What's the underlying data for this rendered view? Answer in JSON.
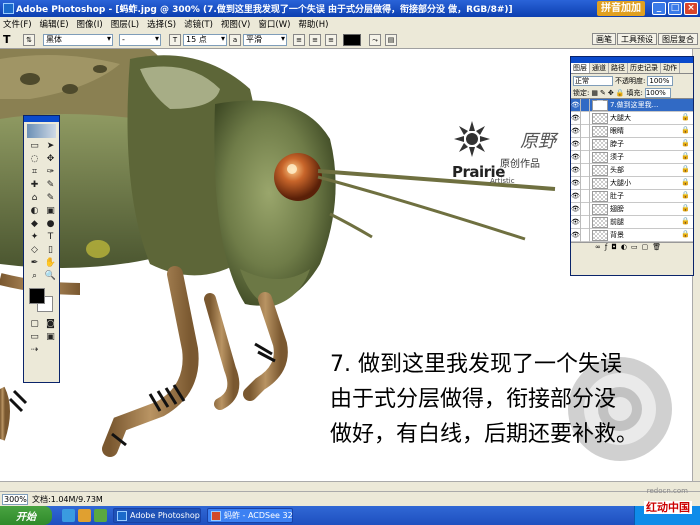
{
  "window": {
    "title": "Adobe Photoshop - [蚂蚱.jpg @ 300% (7.做到这里我发现了一个失误 由于式分层做得，衔接部分没 做，RGB/8#)]",
    "brand_badge": "拼音加加"
  },
  "menu": [
    "文件(F)",
    "编辑(E)",
    "图像(I)",
    "图层(L)",
    "选择(S)",
    "滤镜(T)",
    "视图(V)",
    "窗口(W)",
    "帮助(H)"
  ],
  "options_bar": {
    "tool_glyph": "T",
    "font_family": "黑体",
    "font_style": "-",
    "font_size": "15 点",
    "antialias": "平滑",
    "palette_tabs": [
      "画笔",
      "工具预设",
      "图层复合"
    ]
  },
  "toolbox": {
    "tools": [
      "▭",
      "➤",
      "◌",
      "✥",
      "⌗",
      "✑",
      "✚",
      "✎",
      "⌂",
      "✎",
      "◐",
      "▣",
      "◆",
      "●",
      "✦",
      "T",
      "◇",
      "▯",
      "✒",
      "✋",
      "⌕",
      "🔍"
    ]
  },
  "layers_palette": {
    "tabs": [
      "图层",
      "通道",
      "路径",
      "历史记录",
      "动作"
    ],
    "blend_mode": "正常",
    "opacity_label": "不透明度:",
    "opacity": "100%",
    "lock_label": "锁定:",
    "fill_label": "填充:",
    "fill": "100%",
    "layers": [
      {
        "name": "7.做到这里我...",
        "type": "text",
        "selected": true,
        "locked": false
      },
      {
        "name": "大腿大",
        "type": "image",
        "selected": false,
        "locked": true
      },
      {
        "name": "眼睛",
        "type": "image",
        "selected": false,
        "locked": true
      },
      {
        "name": "脖子",
        "type": "image",
        "selected": false,
        "locked": true
      },
      {
        "name": "须子",
        "type": "image",
        "selected": false,
        "locked": true
      },
      {
        "name": "头部",
        "type": "image",
        "selected": false,
        "locked": true
      },
      {
        "name": "大腿小",
        "type": "image",
        "selected": false,
        "locked": true
      },
      {
        "name": "肚子",
        "type": "image",
        "selected": false,
        "locked": true
      },
      {
        "name": "翅膀",
        "type": "image",
        "selected": false,
        "locked": true
      },
      {
        "name": "前腿",
        "type": "image",
        "selected": false,
        "locked": true
      },
      {
        "name": "背景",
        "type": "image",
        "selected": false,
        "locked": true
      }
    ]
  },
  "canvas": {
    "caption_lines": [
      "7. 做到这里我发现了一个失误",
      "由于式分层做得，衔接部分没",
      "做好，有白线，后期还要补救。"
    ],
    "logo_en": "Prairie",
    "logo_en_small": "Artistic",
    "logo_cn": "原创作品",
    "logo_signature": "原野"
  },
  "status": {
    "zoom": "300%",
    "doc_info": "文档:1.04M/9.73M"
  },
  "taskbar": {
    "start": "开始",
    "items": [
      "Adobe Photoshop ...",
      "蚂蚱 - ACDSee 32"
    ],
    "watermark": "红动中国",
    "watermark_url": "redocn.com"
  },
  "colors": {
    "title_bar": "#1f55c9",
    "chrome": "#ece9d8",
    "insect_green": "#7d8b55",
    "insect_brown": "#a07c4e",
    "eye": "#c0501f"
  }
}
